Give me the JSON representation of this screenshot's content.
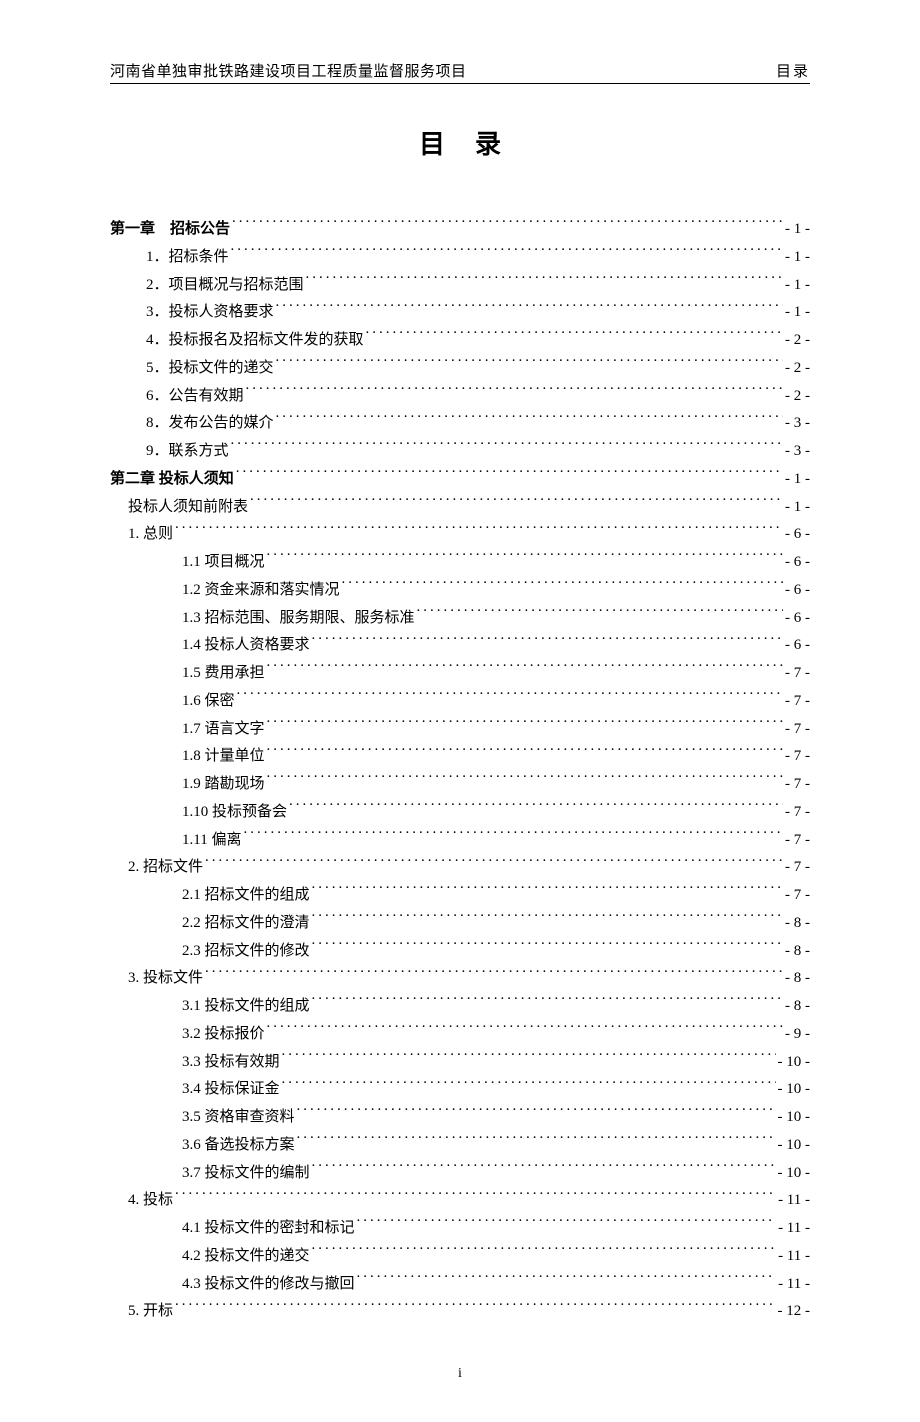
{
  "header": {
    "left": "河南省单独审批铁路建设项目工程质量监督服务项目",
    "right": "目录"
  },
  "title": "目录",
  "footer": "i",
  "toc": [
    {
      "level": "level0",
      "label": "第一章　招标公告",
      "page": "- 1 -"
    },
    {
      "level": "level1",
      "label": "1．招标条件",
      "page": "- 1 -"
    },
    {
      "level": "level1",
      "label": "2．项目概况与招标范围",
      "page": "- 1 -"
    },
    {
      "level": "level1",
      "label": "3．投标人资格要求",
      "page": "- 1 -"
    },
    {
      "level": "level1",
      "label": "4．投标报名及招标文件发的获取",
      "page": "- 2 -"
    },
    {
      "level": "level1",
      "label": "5．投标文件的递交",
      "page": "- 2 -"
    },
    {
      "level": "level1",
      "label": "6．公告有效期",
      "page": "- 2 -"
    },
    {
      "level": "level1",
      "label": "8．发布公告的媒介",
      "page": "- 3 -"
    },
    {
      "level": "level1",
      "label": "9．联系方式",
      "page": "- 3 -"
    },
    {
      "level": "level0",
      "label": "第二章  投标人须知",
      "page": "- 1 -"
    },
    {
      "level": "level1b",
      "label": "投标人须知前附表",
      "page": "- 1 -"
    },
    {
      "level": "level1b",
      "label": "1. 总则",
      "page": "- 6 -"
    },
    {
      "level": "level2",
      "label": "1.1  项目概况",
      "page": "- 6 -"
    },
    {
      "level": "level2",
      "label": "1.2  资金来源和落实情况",
      "page": "- 6 -"
    },
    {
      "level": "level2",
      "label": "1.3  招标范围、服务期限、服务标准",
      "page": "- 6 -"
    },
    {
      "level": "level2",
      "label": "1.4  投标人资格要求",
      "page": "- 6 -"
    },
    {
      "level": "level2",
      "label": "1.5  费用承担",
      "page": "- 7 -"
    },
    {
      "level": "level2",
      "label": "1.6  保密",
      "page": "- 7 -"
    },
    {
      "level": "level2",
      "label": "1.7  语言文字",
      "page": "- 7 -"
    },
    {
      "level": "level2",
      "label": "1.8  计量单位",
      "page": "- 7 -"
    },
    {
      "level": "level2",
      "label": "1.9  踏勘现场",
      "page": "- 7 -"
    },
    {
      "level": "level2",
      "label": "1.10  投标预备会",
      "page": "- 7 -"
    },
    {
      "level": "level2",
      "label": "1.11  偏离",
      "page": "- 7 -"
    },
    {
      "level": "level1b",
      "label": "2. 招标文件",
      "page": "- 7 -"
    },
    {
      "level": "level2",
      "label": "2.1  招标文件的组成",
      "page": "- 7 -"
    },
    {
      "level": "level2",
      "label": "2.2  招标文件的澄清",
      "page": "- 8 -"
    },
    {
      "level": "level2",
      "label": "2.3  招标文件的修改",
      "page": "- 8 -"
    },
    {
      "level": "level1b",
      "label": "3. 投标文件",
      "page": "- 8 -"
    },
    {
      "level": "level2",
      "label": "3.1  投标文件的组成",
      "page": "- 8 -"
    },
    {
      "level": "level2",
      "label": "3.2  投标报价",
      "page": "- 9 -"
    },
    {
      "level": "level2",
      "label": "3.3  投标有效期",
      "page": "- 10 -"
    },
    {
      "level": "level2",
      "label": "3.4  投标保证金",
      "page": "- 10 -"
    },
    {
      "level": "level2",
      "label": "3.5  资格审查资料",
      "page": "- 10 -"
    },
    {
      "level": "level2",
      "label": "3.6  备选投标方案",
      "page": "- 10 -"
    },
    {
      "level": "level2",
      "label": "3.7  投标文件的编制",
      "page": "- 10 -"
    },
    {
      "level": "level1b",
      "label": "4. 投标",
      "page": "- 11 -"
    },
    {
      "level": "level2",
      "label": "4.1  投标文件的密封和标记",
      "page": "- 11 -"
    },
    {
      "level": "level2",
      "label": "4.2  投标文件的递交",
      "page": "- 11 -"
    },
    {
      "level": "level2",
      "label": "4.3  投标文件的修改与撤回",
      "page": "- 11 -"
    },
    {
      "level": "level1b",
      "label": "5. 开标",
      "page": "- 12 -"
    }
  ]
}
